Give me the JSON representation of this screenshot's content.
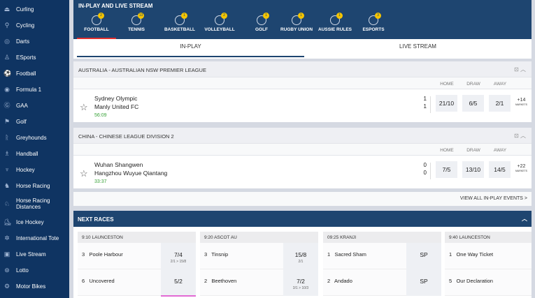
{
  "sidebar": {
    "items": [
      {
        "label": "Curling",
        "icon": "curling-icon"
      },
      {
        "label": "Cycling",
        "icon": "cycling-icon"
      },
      {
        "label": "Darts",
        "icon": "darts-icon"
      },
      {
        "label": "ESports",
        "icon": "esports-icon"
      },
      {
        "label": "Football",
        "icon": "football-icon"
      },
      {
        "label": "Formula 1",
        "icon": "formula1-icon"
      },
      {
        "label": "GAA",
        "icon": "gaa-icon"
      },
      {
        "label": "Golf",
        "icon": "golf-icon"
      },
      {
        "label": "Greyhounds",
        "icon": "greyhound-icon"
      },
      {
        "label": "Handball",
        "icon": "handball-icon"
      },
      {
        "label": "Hockey",
        "icon": "hockey-icon"
      },
      {
        "label": "Horse Racing",
        "icon": "horse-racing-icon"
      },
      {
        "label": "Horse Racing Distances",
        "icon": "horse-racing-distances-icon"
      },
      {
        "label": "Ice Hockey",
        "icon": "ice-hockey-icon"
      },
      {
        "label": "International Tote",
        "icon": "tote-icon"
      },
      {
        "label": "Live Stream",
        "icon": "tv-icon"
      },
      {
        "label": "Lotto",
        "icon": "lotto-icon"
      },
      {
        "label": "Motor Bikes",
        "icon": "motorbike-icon"
      }
    ]
  },
  "inplay": {
    "title": "IN-PLAY AND LIVE STREAM",
    "sports": [
      {
        "label": "FOOTBALL",
        "count": "2"
      },
      {
        "label": "TENNIS",
        "count": "13"
      },
      {
        "label": "BASKETBALL",
        "count": "1"
      },
      {
        "label": "VOLLEYBALL",
        "count": "2"
      },
      {
        "label": "GOLF",
        "count": "1"
      },
      {
        "label": "RUGBY UNION",
        "count": "1"
      },
      {
        "label": "AUSSIE RULES",
        "count": "1"
      },
      {
        "label": "ESPORTS",
        "count": "3"
      }
    ],
    "subtabs": [
      "IN-PLAY",
      "LIVE STREAM"
    ],
    "columns": {
      "home": "HOME",
      "draw": "DRAW",
      "away": "AWAY"
    },
    "leagues": [
      {
        "name": "AUSTRALIA - AUSTRALIAN NSW PREMIER LEAGUE",
        "home_team": "Sydney Olympic",
        "away_team": "Manly United FC",
        "time": "56:09",
        "home_score": "1",
        "away_score": "1",
        "odds": [
          "21/10",
          "6/5",
          "2/1"
        ],
        "more": "+14",
        "more_label": "MARKETS"
      },
      {
        "name": "CHINA - CHINESE LEAGUE DIVISION 2",
        "home_team": "Wuhan Shangwen",
        "away_team": "Hangzhou Wuyue Qiantang",
        "time": "33:37",
        "home_score": "0",
        "away_score": "0",
        "odds": [
          "7/5",
          "13/10",
          "14/5"
        ],
        "more": "+22",
        "more_label": "MARKETS"
      }
    ],
    "view_all": "VIEW ALL IN-PLAY EVENTS >"
  },
  "races": {
    "title": "NEXT RACES",
    "cards": [
      {
        "title": "9:10 LAUNCESTON",
        "runners": [
          {
            "num": "3",
            "name": "Poole Harbour",
            "odds": "7/4",
            "history": "2/1 > 15/8"
          },
          {
            "num": "6",
            "name": "Uncovered",
            "odds": "5/2",
            "history": ""
          }
        ]
      },
      {
        "title": "9:20 ASCOT AU",
        "runners": [
          {
            "num": "3",
            "name": "Tinsnip",
            "odds": "15/8",
            "history": "2/1"
          },
          {
            "num": "2",
            "name": "Beethoven",
            "odds": "7/2",
            "history": "3/1 > 10/3"
          }
        ]
      },
      {
        "title": "09:25 KRANJI",
        "runners": [
          {
            "num": "1",
            "name": "Sacred Sham",
            "odds": "SP",
            "history": ""
          },
          {
            "num": "2",
            "name": "Andado",
            "odds": "SP",
            "history": ""
          }
        ]
      },
      {
        "title": "9:40 LAUNCESTON",
        "runners": [
          {
            "num": "1",
            "name": "One Way Ticket",
            "odds": "",
            "history": ""
          },
          {
            "num": "5",
            "name": "Our Declaration",
            "odds": "",
            "history": ""
          }
        ]
      }
    ]
  }
}
